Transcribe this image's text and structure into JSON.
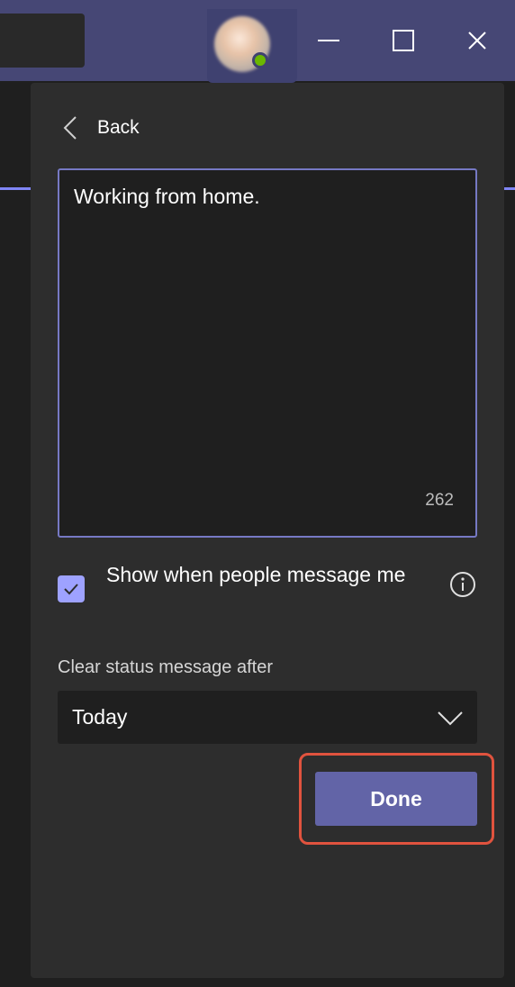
{
  "titlebar": {
    "window_controls": {
      "minimize_icon": "minimize-icon",
      "maximize_icon": "maximize-icon",
      "close_icon": "close-icon"
    },
    "presence": "available"
  },
  "panel": {
    "back_label": "Back",
    "message": {
      "value": "Working from home.",
      "remaining_chars": "262"
    },
    "show_when_message": {
      "label": "Show when people message me",
      "checked": true
    },
    "clear_after": {
      "label": "Clear status message after",
      "selected": "Today"
    },
    "done_label": "Done"
  },
  "colors": {
    "titlebar": "#464775",
    "accent": "#6264a7",
    "checkbox": "#9ea2ff",
    "input_border": "#7679c4",
    "highlight": "#e0533e"
  }
}
